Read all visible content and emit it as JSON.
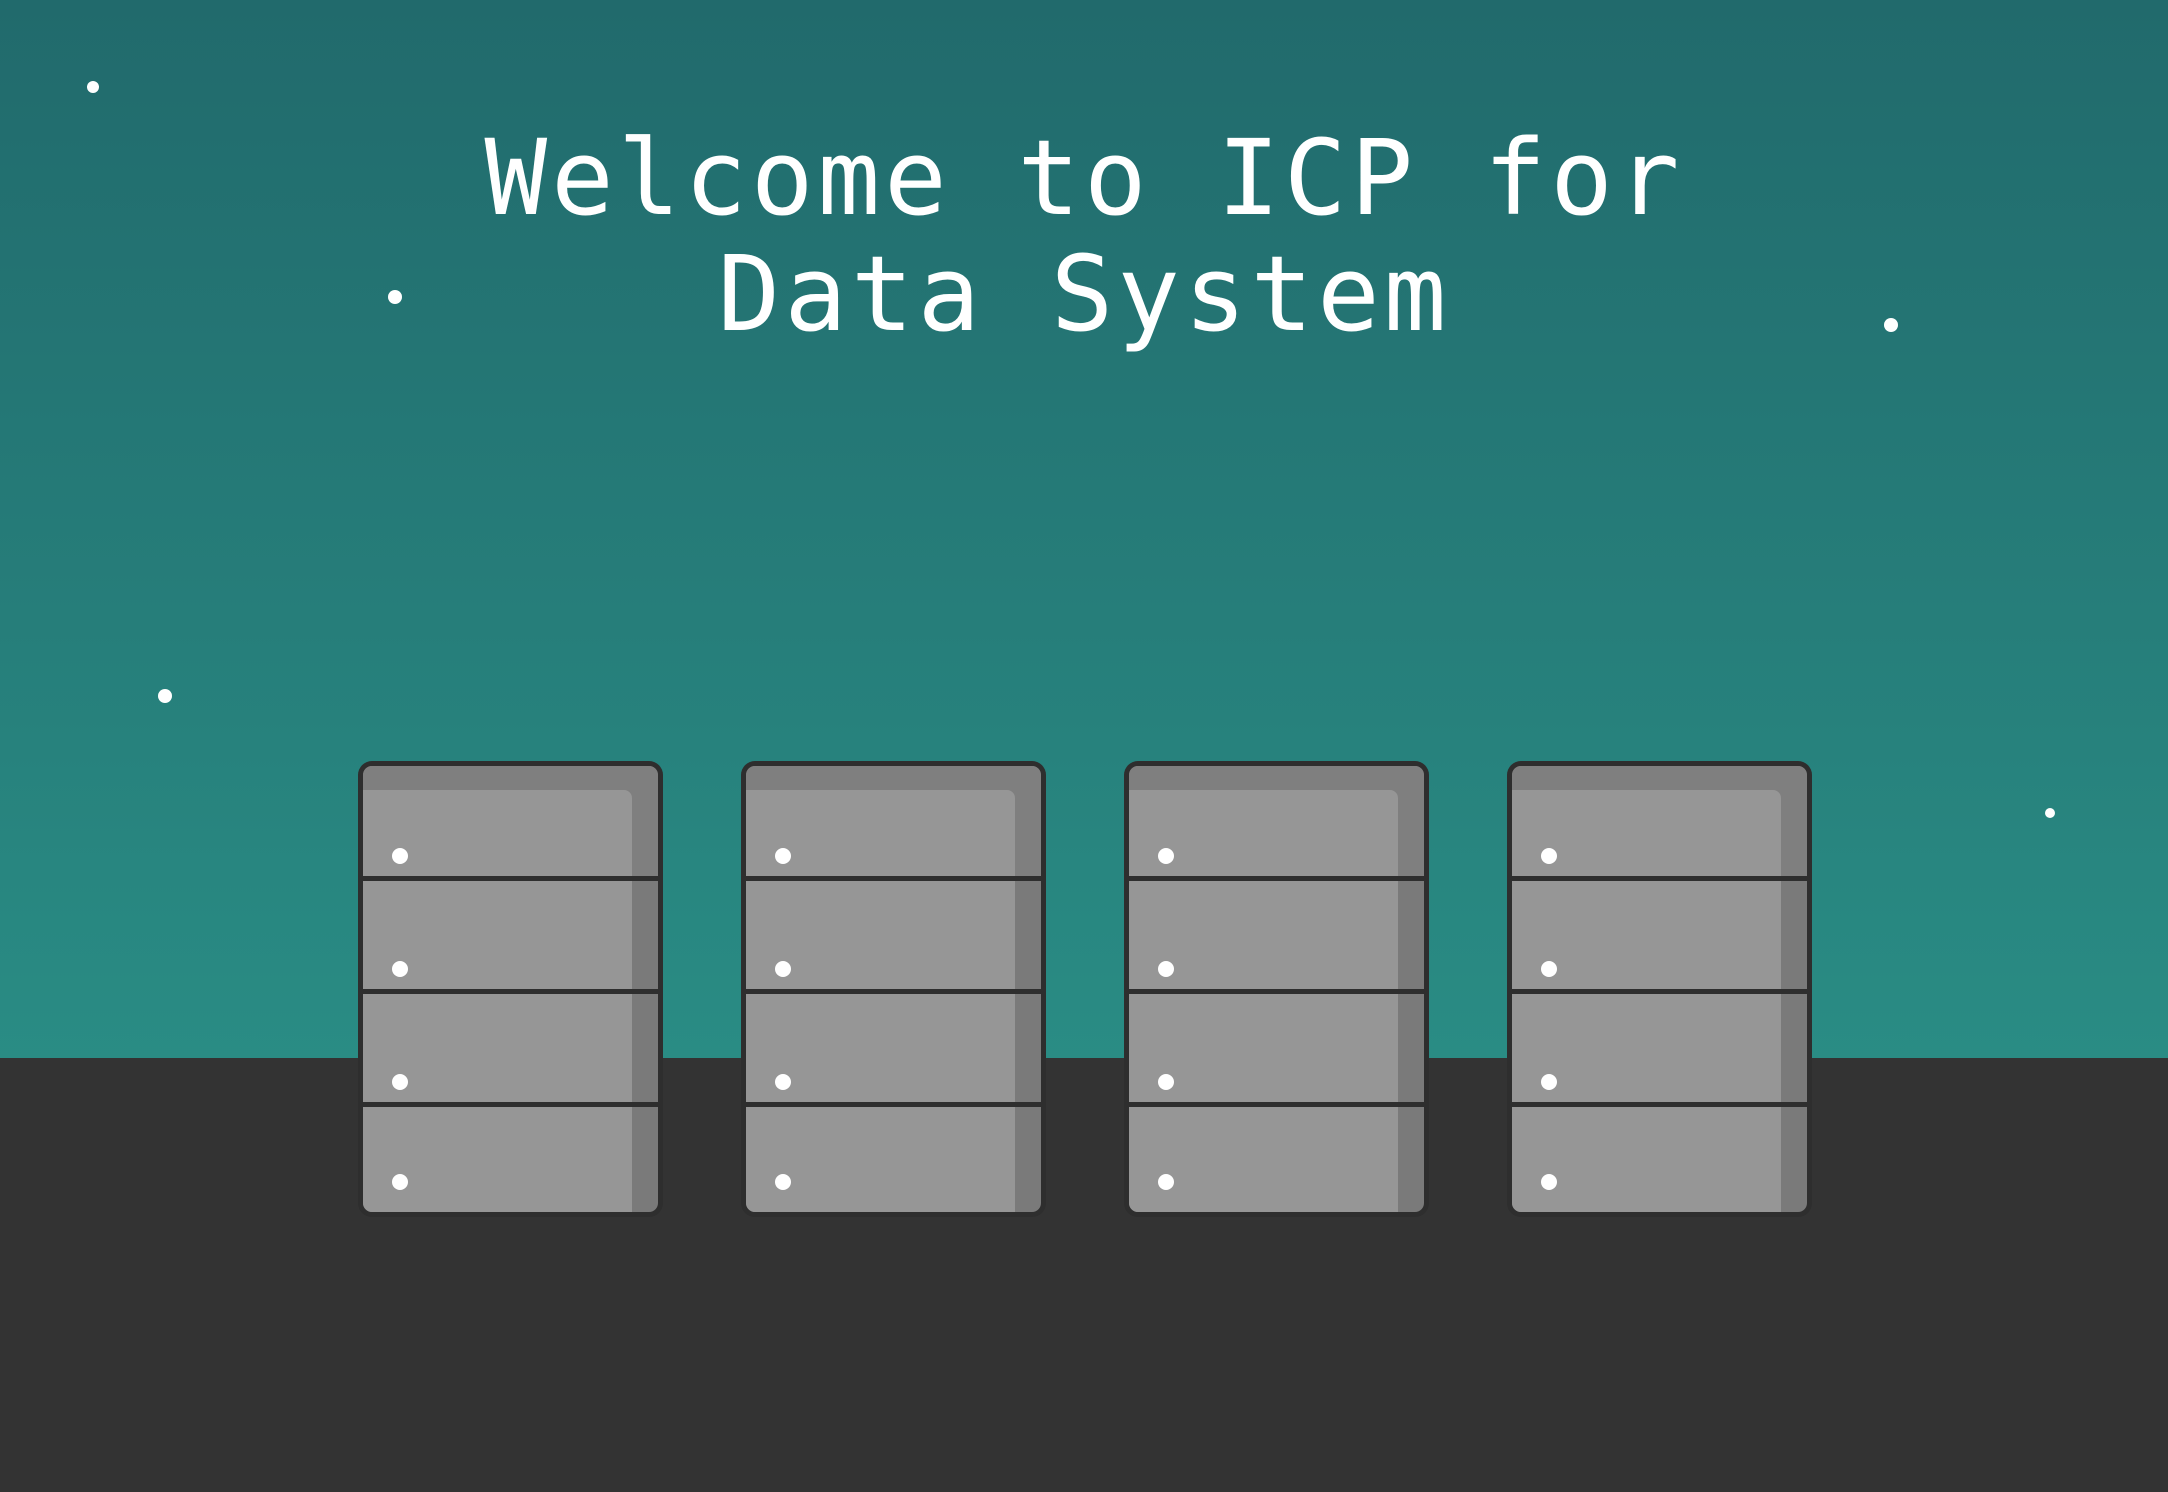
{
  "welcome": {
    "title_line1": "Welcome to ICP for",
    "title_line2": "Data System"
  },
  "colors": {
    "sky_top": "#216a6c",
    "sky_bottom": "#2d9a8e",
    "ground": "#333333",
    "server_body": "#969696",
    "server_outline": "#2e2e2e",
    "led": "#ffffff"
  },
  "illustration": {
    "server_count": 4,
    "drives_per_server": 4,
    "star_icon": "star-dot"
  }
}
